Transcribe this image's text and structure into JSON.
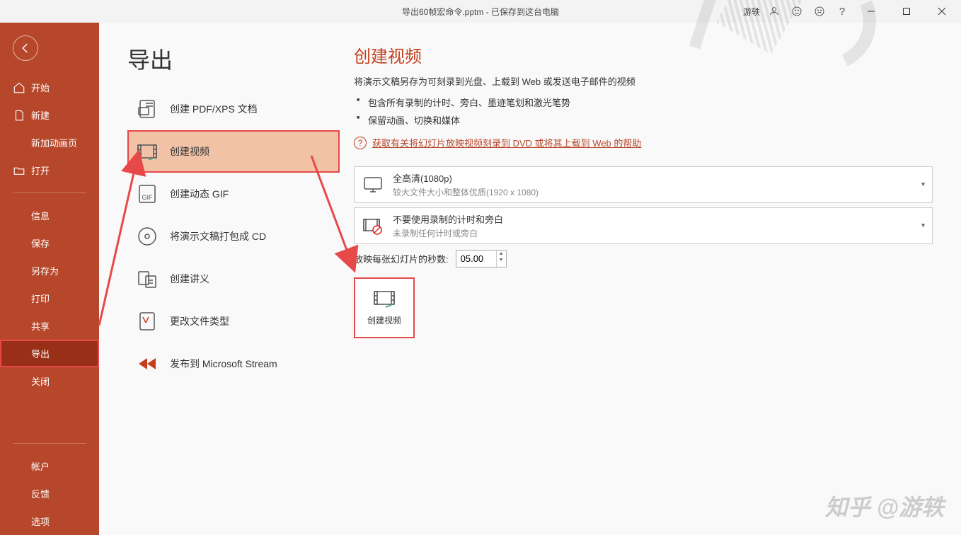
{
  "titlebar": {
    "title": "导出60帧宏命令.pptm - 已保存到这台电脑",
    "user": "游轶",
    "help_symbol": "?"
  },
  "sidebar": {
    "back_aria": "返回",
    "items": [
      {
        "label": "开始"
      },
      {
        "label": "新建"
      },
      {
        "label": "新加动画页"
      },
      {
        "label": "打开"
      },
      {
        "label": "信息"
      },
      {
        "label": "保存"
      },
      {
        "label": "另存为"
      },
      {
        "label": "打印"
      },
      {
        "label": "共享"
      },
      {
        "label": "导出"
      },
      {
        "label": "关闭"
      }
    ],
    "footer": [
      {
        "label": "帐户"
      },
      {
        "label": "反馈"
      },
      {
        "label": "选项"
      }
    ]
  },
  "page": {
    "title": "导出",
    "exportOptions": [
      {
        "label": "创建 PDF/XPS 文档"
      },
      {
        "label": "创建视频"
      },
      {
        "label": "创建动态 GIF"
      },
      {
        "label": "将演示文稿打包成 CD"
      },
      {
        "label": "创建讲义"
      },
      {
        "label": "更改文件类型"
      },
      {
        "label": "发布到 Microsoft Stream"
      }
    ]
  },
  "detail": {
    "title": "创建视频",
    "desc": "将演示文稿另存为可刻录到光盘、上载到 Web 或发送电子邮件的视频",
    "bullets": [
      "包含所有录制的计时、旁白、墨迹笔划和激光笔势",
      "保留动画、切换和媒体"
    ],
    "helpLink": "获取有关将幻灯片放映视频刻录到 DVD 或将其上载到 Web 的帮助",
    "qualityDropdown": {
      "title": "全高清(1080p)",
      "sub": "较大文件大小和整体优质(1920 x 1080)"
    },
    "narrationDropdown": {
      "title": "不要使用录制的计时和旁白",
      "sub": "未录制任何计时或旁白"
    },
    "secondsLabel": "放映每张幻灯片的秒数:",
    "secondsValue": "05.00",
    "createButton": "创建视频"
  },
  "watermark": "知乎 @游轶"
}
